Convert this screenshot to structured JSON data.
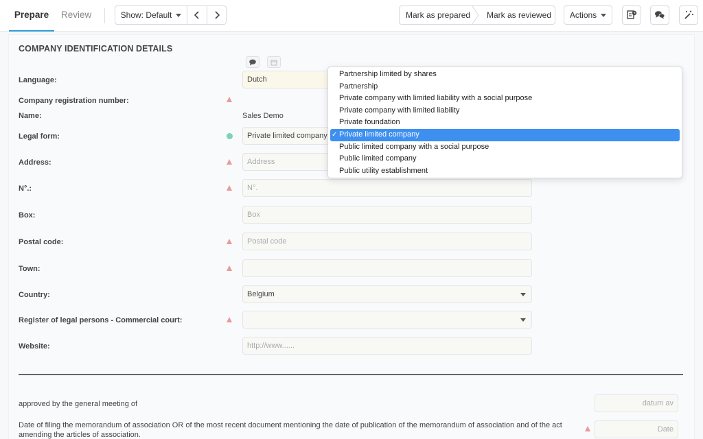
{
  "toolbar": {
    "tabs": [
      {
        "label": "Prepare"
      },
      {
        "label": "Review"
      }
    ],
    "show_label": "Show: Default",
    "prev_icon": "chevron-left-icon",
    "next_icon": "chevron-right-icon",
    "mark_prepared": "Mark as prepared",
    "mark_reviewed": "Mark as reviewed",
    "actions": "Actions",
    "icons": [
      "document-clock-icon",
      "chat-bubbles-icon",
      "magic-wand-icon"
    ]
  },
  "section": {
    "title": "COMPANY IDENTIFICATION DETAILS"
  },
  "form": {
    "language": {
      "label": "Language:",
      "value": "Dutch"
    },
    "registration": {
      "label": "Company registration number:"
    },
    "name": {
      "label": "Name:",
      "value": "Sales Demo"
    },
    "legal_form": {
      "label": "Legal form:",
      "value": "Private limited company"
    },
    "address": {
      "label": "Address:",
      "placeholder": "Address"
    },
    "number": {
      "label": "N°.:",
      "placeholder": "N°."
    },
    "box": {
      "label": "Box:",
      "placeholder": "Box"
    },
    "postal_code": {
      "label": "Postal code:",
      "placeholder": "Postal code"
    },
    "town": {
      "label": "Town:",
      "value": ""
    },
    "country": {
      "label": "Country:",
      "value": "Belgium"
    },
    "register": {
      "label": "Register of legal persons - Commercial court:",
      "value": ""
    },
    "website": {
      "label": "Website:",
      "placeholder": "http://www......"
    }
  },
  "lower": {
    "approved": {
      "label": "approved by the general meeting of",
      "placeholder": "datum av"
    },
    "filing": {
      "label_line1": "Date of filing the memorandum of association OR of the most recent document mentioning the date of publication of the memorandum of association and of the act",
      "label_line2": "amending the articles of association.",
      "placeholder": "Date"
    }
  },
  "dropdown": {
    "options": [
      "Partnership limited by shares",
      "Partnership",
      "Private company with limited liability with a social purpose",
      "Private company with limited liability",
      "Private foundation",
      "Private limited company",
      "Public limited company with a social purpose",
      "Public limited company",
      "Public utility establishment"
    ],
    "selected_index": 5,
    "check": "✓"
  },
  "colors": {
    "accent": "#2e9bd6",
    "selected_option": "#3d8ff0",
    "warning": "#e89a9a",
    "ok": "#7ed3b2"
  }
}
